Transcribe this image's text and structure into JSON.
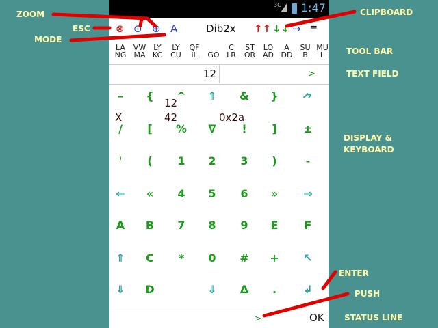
{
  "status_bar": {
    "network": "3G",
    "time": "1:47"
  },
  "header": {
    "esc_icon": "⊗",
    "zoom_out_icon": "⊙",
    "zoom_in_icon": "⊕",
    "mode_label": "A",
    "title": "Dib2x",
    "clip_up": "↑↑",
    "clip_down": "↓↓",
    "clip_arrow": "→",
    "clip_eq": "="
  },
  "toolbar": {
    "items": [
      {
        "top": "LA",
        "bottom": "NG"
      },
      {
        "top": "VW",
        "bottom": "MA"
      },
      {
        "top": "LY",
        "bottom": "KC"
      },
      {
        "top": "LY",
        "bottom": "CU"
      },
      {
        "top": "QF",
        "bottom": "IL"
      },
      {
        "top": "",
        "bottom": "GO"
      },
      {
        "top": "C",
        "bottom": "LR"
      },
      {
        "top": "ST",
        "bottom": "OR"
      },
      {
        "top": "LO",
        "bottom": "AD"
      },
      {
        "top": "A",
        "bottom": "DD"
      },
      {
        "top": "SU",
        "bottom": "B"
      },
      {
        "top": "MU",
        "bottom": "L"
      }
    ]
  },
  "text_field": {
    "value": "12",
    "prompt": ">"
  },
  "display": {
    "line1": "12",
    "line2_label": "X",
    "line2_value": "42",
    "line2_hex": "0x2a"
  },
  "keyboard": {
    "rows": [
      [
        "–",
        "{",
        "^",
        "⇑",
        "&",
        "}",
        "⺈"
      ],
      [
        "/",
        "[",
        "%",
        "∇",
        "!",
        "]",
        "±"
      ],
      [
        "'",
        "(",
        "1",
        "2",
        "3",
        ")",
        "-"
      ],
      [
        "⇐",
        "«",
        "4",
        "5",
        "6",
        "»",
        "⇒"
      ],
      [
        "A",
        "B",
        "7",
        "8",
        "9",
        "E",
        "F"
      ],
      [
        "⇑",
        "C",
        "*",
        "0",
        "#",
        "+",
        "↖"
      ],
      [
        "⇓",
        "D",
        "",
        "⇓",
        "Δ",
        ".",
        "↲"
      ]
    ]
  },
  "status_line": {
    "prompt": ">",
    "text": "OK"
  },
  "annotations": {
    "zoom": "ZOOM",
    "esc": "ESC",
    "mode": "MODE",
    "clipboard": "CLIPBOARD",
    "tool_bar": "TOOL BAR",
    "text_field": "TEXT FIELD",
    "display_keyboard_1": "DISPLAY &",
    "display_keyboard_2": "KEYBOARD",
    "enter": "ENTER",
    "push": "PUSH",
    "status_line": "STATUS LINE"
  },
  "colors": {
    "background": "#4a928f",
    "annotation": "#fff8a8",
    "arrow": "#e00000",
    "key_green": "#1a9e1a",
    "key_teal": "#2aa5a0"
  }
}
